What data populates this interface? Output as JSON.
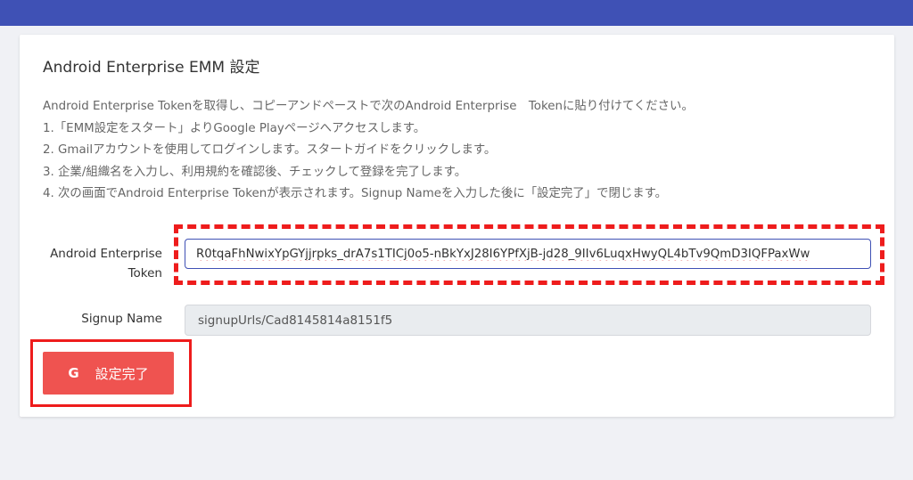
{
  "card": {
    "title": "Android Enterprise EMM 設定",
    "instructions": [
      "Android Enterprise Tokenを取得し、コピーアンドペーストで次のAndroid Enterprise　Tokenに貼り付けてください。",
      "1.「EMM設定をスタート」よりGoogle Playページへアクセスします。",
      "2. Gmailアカウントを使用してログインします。スタートガイドをクリックします。",
      "3. 企業/組織名を入力し、利用規約を確認後、チェックして登録を完了します。",
      "4. 次の画面でAndroid Enterprise Tokenが表示されます。Signup Nameを入力した後に「設定完了」で閉じます。"
    ]
  },
  "form": {
    "token_label_line1": "Android Enterprise",
    "token_label_line2": "Token",
    "token_value": "R0tqaFhNwixYpGYjjrpks_drA7s1TICj0o5-nBkYxJ28I6YPfXjB-jd28_9IIv6LuqxHwyQL4bTv9QmD3IQFPaxWw",
    "signup_label": "Signup Name",
    "signup_value": "signupUrls/Cad8145814a8151f5"
  },
  "button": {
    "icon_glyph": "G",
    "icon_name": "google-icon",
    "label": "設定完了"
  },
  "colors": {
    "topbar": "#3f51b5",
    "button": "#ef5350",
    "highlight": "#ee1c1c"
  }
}
